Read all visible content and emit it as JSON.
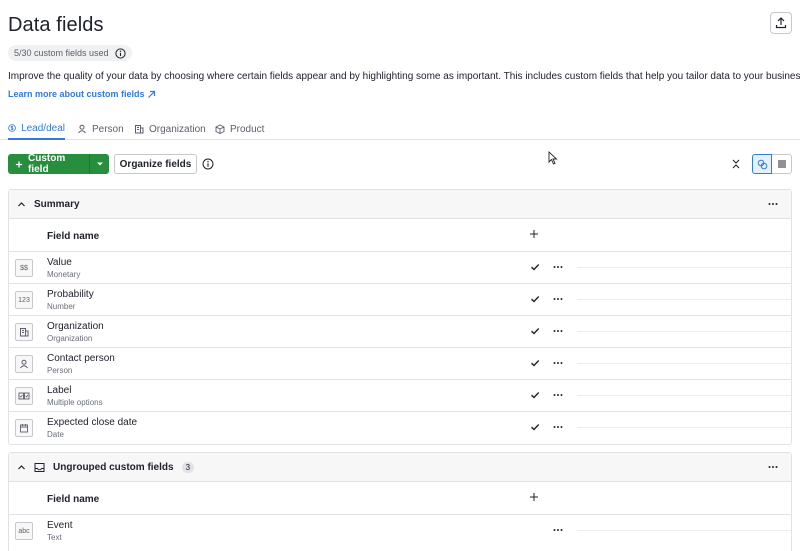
{
  "page": {
    "title": "Data fields",
    "usage": "5/30 custom fields used",
    "description": "Improve the quality of your data by choosing where certain fields appear and by highlighting some as important. This includes custom fields that help you tailor data to your business' needs.",
    "learn_more": "Learn more about custom fields"
  },
  "tabs": [
    {
      "label": "Lead/deal",
      "icon": "dollar-circle-icon",
      "active": true
    },
    {
      "label": "Person",
      "icon": "person-icon",
      "active": false
    },
    {
      "label": "Organization",
      "icon": "building-icon",
      "active": false
    },
    {
      "label": "Product",
      "icon": "box-icon",
      "active": false
    }
  ],
  "toolbar": {
    "custom_field": "Custom field",
    "organize_fields": "Organize fields"
  },
  "colors": {
    "accent": "#317ae2",
    "primary_green": "#268e3c"
  },
  "groups": [
    {
      "title": "Summary",
      "column_header": "Field name",
      "rows": [
        {
          "name": "Value",
          "type": "Monetary",
          "icon": "$$",
          "checked": true
        },
        {
          "name": "Probability",
          "type": "Number",
          "icon": "123",
          "checked": true
        },
        {
          "name": "Organization",
          "type": "Organization",
          "icon": "building-icon",
          "checked": true
        },
        {
          "name": "Contact person",
          "type": "Person",
          "icon": "person-icon",
          "checked": true
        },
        {
          "name": "Label",
          "type": "Multiple options",
          "icon": "multi-options-icon",
          "checked": true
        },
        {
          "name": "Expected close date",
          "type": "Date",
          "icon": "calendar-icon",
          "checked": true
        }
      ]
    },
    {
      "title": "Ungrouped custom fields",
      "count": "3",
      "column_header": "Field name",
      "rows": [
        {
          "name": "Event",
          "type": "Text",
          "icon": "abc",
          "checked": false
        }
      ]
    }
  ]
}
